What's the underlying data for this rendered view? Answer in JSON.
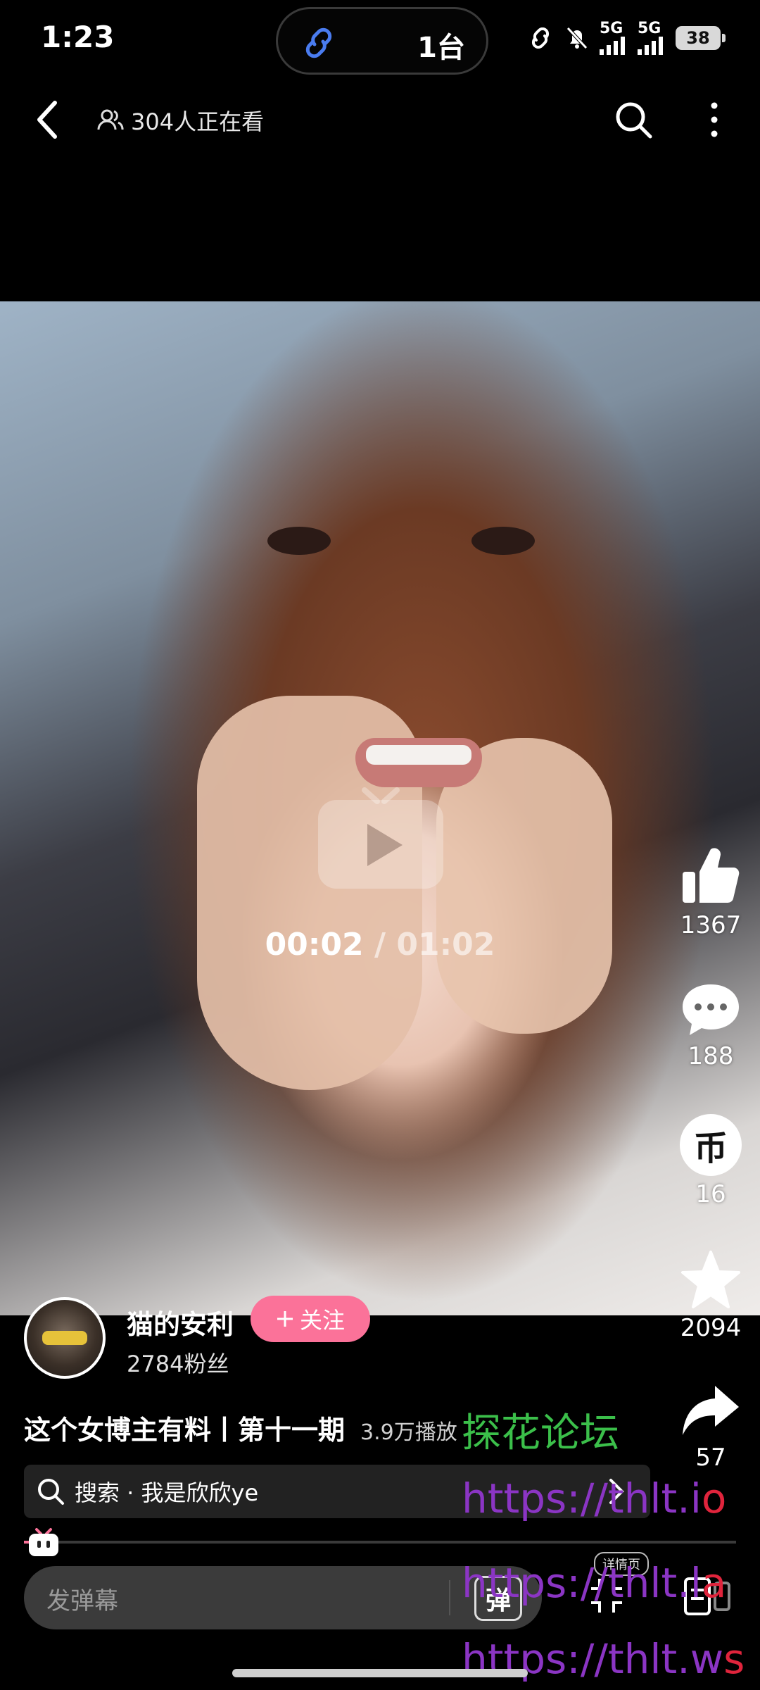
{
  "status_bar": {
    "time": "1:23",
    "island_count": "1台",
    "network_1": "5G",
    "network_2": "5G",
    "battery": "38"
  },
  "top_nav": {
    "viewers": "304人正在看",
    "icons": [
      "back-arrow-icon",
      "users-icon",
      "search-icon",
      "more-vertical-icon"
    ]
  },
  "video": {
    "progress": 0.032,
    "current_time": "00:02",
    "separator": "/",
    "duration": "01:02"
  },
  "actions": {
    "like_count": "1367",
    "comment_count": "188",
    "coin_label": "币",
    "coin_count": "16",
    "favorite_count": "2094",
    "share_count": "57"
  },
  "author": {
    "name": "猫的安利",
    "follow_label": "关注",
    "fans": "2784粉丝"
  },
  "caption": {
    "title": "这个女博主有料丨第十一期",
    "plays": "3.9万播放"
  },
  "search": {
    "text": "搜索 · 我是欣欣ye"
  },
  "bottom": {
    "danmu_placeholder": "发弹幕",
    "danmu_toggle": "弹",
    "detail_label": "详情页"
  },
  "watermarks": {
    "forum": "探花论坛",
    "url1_main": "https://thlt.i",
    "url1_tail": "o",
    "url2_main": "https://thlt.l",
    "url2_tail": "a",
    "url3_main": "https://thlt.w",
    "url3_tail": "s"
  },
  "colors": {
    "accent_pink": "#fb7299",
    "watermark_green": "#3bbf4a",
    "watermark_purple": "#8b35c4",
    "watermark_red": "#e0243c"
  }
}
